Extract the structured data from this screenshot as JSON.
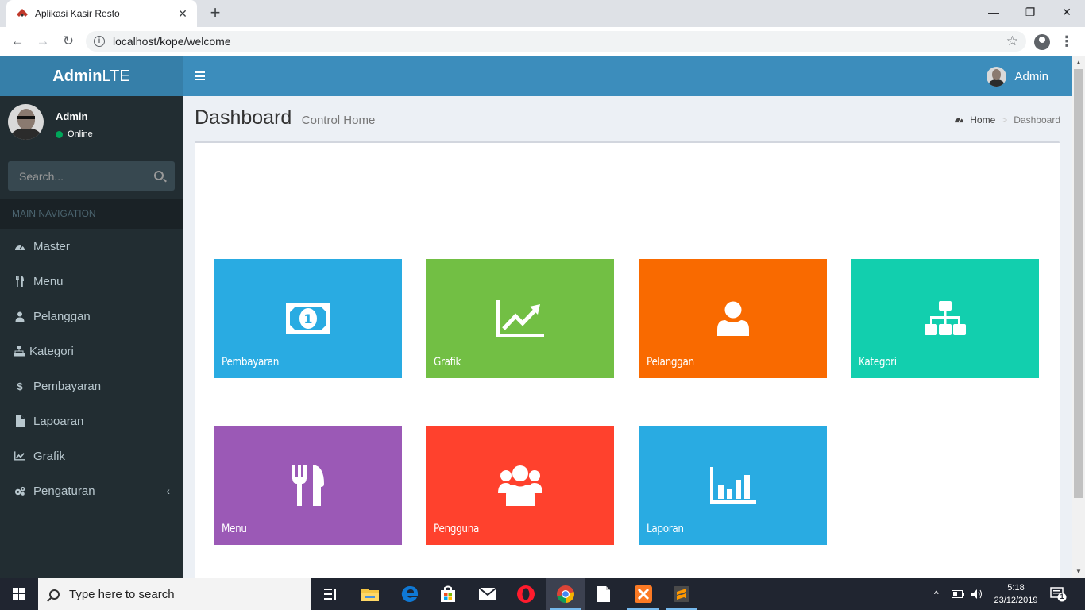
{
  "browser": {
    "tab_title": "Aplikasi Kasir Resto",
    "tab_close": "✕",
    "new_tab": "+",
    "url": "localhost/kope/welcome",
    "window": {
      "minimize": "—",
      "restore": "❐",
      "close": "✕"
    }
  },
  "app": {
    "logo_bold": "Admin",
    "logo_light": "LTE",
    "header_user": "Admin"
  },
  "sidebar": {
    "user_name": "Admin",
    "user_status": "Online",
    "search_placeholder": "Search...",
    "nav_header": "MAIN NAVIGATION",
    "items": [
      {
        "label": "Master",
        "icon": "dashboard-icon",
        "glyph": "◕"
      },
      {
        "label": "Menu",
        "icon": "cutlery-icon",
        "glyph": "🍴"
      },
      {
        "label": "Pelanggan",
        "icon": "user-icon",
        "glyph": "●"
      },
      {
        "label": "Kategori",
        "icon": "sitemap-icon",
        "glyph": "⊞"
      },
      {
        "label": "Pembayaran",
        "icon": "dollar-icon",
        "glyph": "$"
      },
      {
        "label": "Lapoaran",
        "icon": "file-icon",
        "glyph": "▮"
      },
      {
        "label": "Grafik",
        "icon": "line-chart-icon",
        "glyph": "⟋"
      },
      {
        "label": "Pengaturan",
        "icon": "cogs-icon",
        "glyph": "⚙",
        "chevron": "‹"
      }
    ]
  },
  "content": {
    "title": "Dashboard",
    "subtitle": "Control Home",
    "breadcrumb": {
      "home": "Home",
      "separator": ">",
      "current": "Dashboard"
    }
  },
  "tiles": [
    {
      "label": "Pembayaran",
      "icon": "money-icon",
      "color": "#29abe2"
    },
    {
      "label": "Grafik",
      "icon": "line-chart-icon",
      "color": "#72bf44"
    },
    {
      "label": "Pelanggan",
      "icon": "user-icon",
      "color": "#f96a00"
    },
    {
      "label": "Kategori",
      "icon": "sitemap-icon",
      "color": "#12cfae"
    },
    {
      "label": "Menu",
      "icon": "cutlery-icon",
      "color": "#9b59b6"
    },
    {
      "label": "Pengguna",
      "icon": "users-icon",
      "color": "#ff412d"
    },
    {
      "label": "Laporan",
      "icon": "bar-chart-icon",
      "color": "#29abe2"
    }
  ],
  "taskbar": {
    "search_text": "Type here to search",
    "time": "5:18",
    "date": "23/12/2019",
    "notification_count": "1"
  }
}
